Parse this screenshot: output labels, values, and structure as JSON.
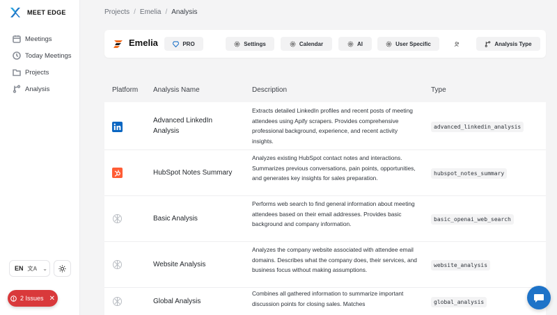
{
  "brand": {
    "name": "MEET EDGE"
  },
  "nav": [
    {
      "label": "Meetings",
      "icon": "calendar-icon"
    },
    {
      "label": "Today Meetings",
      "icon": "clock-icon"
    },
    {
      "label": "Projects",
      "icon": "folder-icon"
    },
    {
      "label": "Analysis",
      "icon": "branch-icon"
    }
  ],
  "lang": {
    "code": "EN"
  },
  "issues": {
    "label": "2 Issues"
  },
  "breadcrumb": [
    "Projects",
    "Emelia",
    "Analysis"
  ],
  "project": {
    "name": "Emelia",
    "plan": "PRO",
    "actions": [
      "Settings",
      "Calendar",
      "AI",
      "User Specific",
      "Analysis Type"
    ]
  },
  "table": {
    "headers": [
      "Platform",
      "Analysis Name",
      "Description",
      "Type"
    ],
    "rows": [
      {
        "platform": "linkedin-icon",
        "name": "Advanced LinkedIn Analysis",
        "desc": "Extracts detailed LinkedIn profiles and recent posts of meeting attendees using Apify scrapers. Provides comprehensive professional background, experience, and recent activity insights.",
        "type": "advanced_linkedin_analysis"
      },
      {
        "platform": "hubspot-icon",
        "name": "HubSpot Notes Summary",
        "desc": "Analyzes existing HubSpot contact notes and interactions. Summarizes previous conversations, pain points, opportunities, and generates key insights for sales preparation.",
        "type": "hubspot_notes_summary"
      },
      {
        "platform": "openai-icon",
        "name": "Basic Analysis",
        "desc": "Performs web search to find general information about meeting attendees based on their email addresses. Provides basic background and company information.",
        "type": "basic_openai_web_search"
      },
      {
        "platform": "openai-icon",
        "name": "Website Analysis",
        "desc": "Analyzes the company website associated with attendee email domains. Describes what the company does, their services, and business focus without making assumptions.",
        "type": "website_analysis"
      },
      {
        "platform": "openai-icon",
        "name": "Global Analysis",
        "desc": "Combines all gathered information to summarize important discussion points for closing sales. Matches",
        "type": "global_analysis"
      }
    ]
  },
  "colors": {
    "issues": "#d9393b",
    "chat": "#1e73c8",
    "linkedin": "#0a66c2",
    "hubspot": "#ff5c35"
  }
}
